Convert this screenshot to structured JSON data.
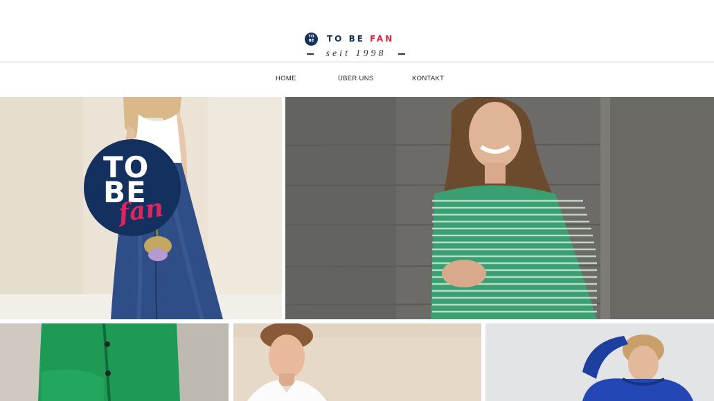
{
  "brand": {
    "badge_top": "TO",
    "badge_bottom": "BE",
    "name_main": "TO BE",
    "name_accent": "FAN",
    "since": "seit 1998"
  },
  "nav": {
    "items": [
      {
        "label": "HOME"
      },
      {
        "label": "ÜBER UNS"
      },
      {
        "label": "KONTAKT"
      }
    ]
  },
  "hero_logo": {
    "line1": "TO",
    "line2": "BE",
    "script": "fan"
  },
  "colors": {
    "navy": "#13305e",
    "accent_red": "#e0243c",
    "accent_pink": "#e0245e"
  },
  "images": [
    {
      "icon": "photo-woman-denim-artichoke"
    },
    {
      "icon": "photo-woman-green-striped-sweater"
    },
    {
      "icon": "photo-green-cardigan"
    },
    {
      "icon": "photo-man-white-shirt"
    },
    {
      "icon": "photo-woman-blue-hoodie"
    }
  ]
}
